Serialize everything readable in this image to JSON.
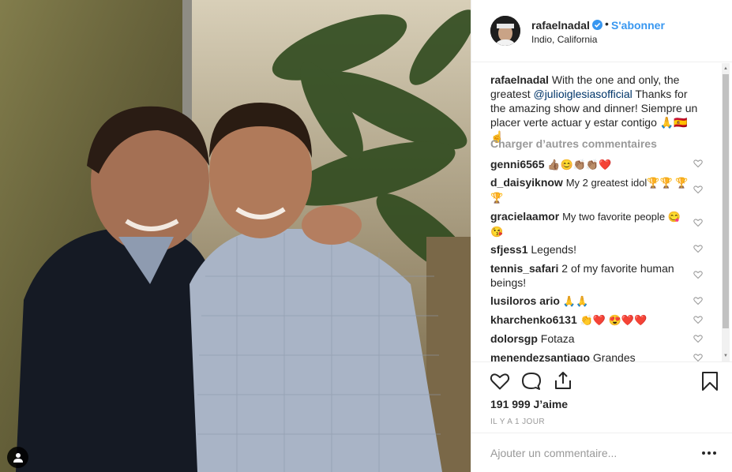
{
  "post": {
    "username": "rafaelnadal",
    "follow_label": "S'abonner",
    "location": "Indio, California",
    "caption": {
      "username": "rafaelnadal",
      "text_before": "With the one and only, the greatest ",
      "mention": "@julioiglesiasofficial",
      "text_after": " Thanks for the amazing show and dinner! Siempre un placer verte actuar y estar contigo 🙏🇪🇸☝️"
    },
    "load_more_label": "Charger d’autres commentaires",
    "comments": [
      {
        "username": "genni6565",
        "text": "👍🏽😊👏🏽👏🏽❤️"
      },
      {
        "username": "d_daisyiknow",
        "text": "My 2 greatest idol🏆🏆 🏆🏆"
      },
      {
        "username": "gracielaamor",
        "text": "My two favorite people 😋😘"
      },
      {
        "username": "sfjess1",
        "text": "Legends!"
      },
      {
        "username": "tennis_safari",
        "text": "2 of my favorite human beings!"
      },
      {
        "username": "lusiloros ario",
        "text": "🙏🙏"
      },
      {
        "username": "kharchenko6131",
        "text": "👏❤️ 😍❤️❤️"
      },
      {
        "username": "dolorsgp",
        "text": "Fotaza"
      },
      {
        "username": "menendezsantiago",
        "text": "Grandes"
      }
    ],
    "likes_label": "191 999 J’aime",
    "time_label": "IL Y A 1 JOUR",
    "add_comment_placeholder": "Ajouter un commentaire..."
  },
  "colors": {
    "link": "#3897f0",
    "mention": "#003569",
    "verified": "#3897f0",
    "muted": "#999999",
    "text": "#262626"
  },
  "icons": [
    "verified-badge-icon",
    "heart-icon",
    "comment-icon",
    "share-icon",
    "bookmark-icon",
    "more-options-icon",
    "user-tag-icon"
  ]
}
